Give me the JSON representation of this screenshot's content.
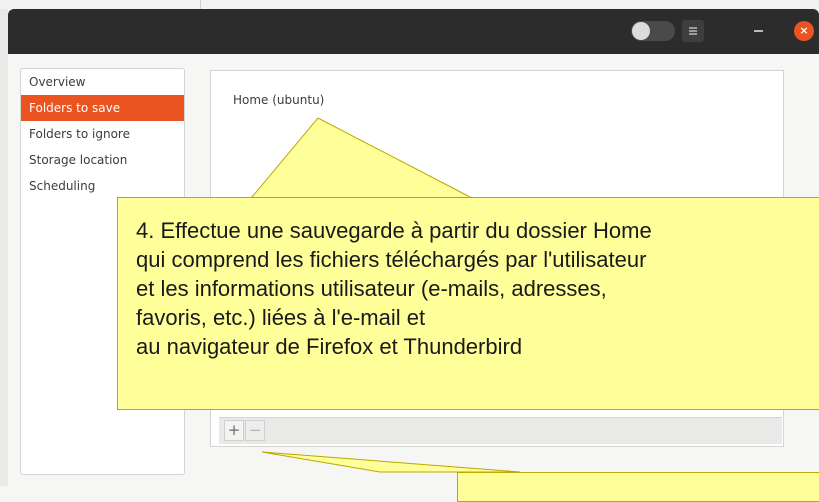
{
  "window": {
    "controls": {
      "toggle_icon": "toggle-switch-icon",
      "menu_icon": "hamburger-menu-icon",
      "minimize_icon": "minimize-icon",
      "close_icon": "close-icon",
      "close_glyph": "×"
    },
    "accent_color": "#e95420"
  },
  "sidebar": {
    "items": [
      {
        "label": "Overview"
      },
      {
        "label": "Folders to save"
      },
      {
        "label": "Folders to ignore"
      },
      {
        "label": "Storage location"
      },
      {
        "label": "Scheduling"
      }
    ],
    "active_index": 1
  },
  "main": {
    "folders": [
      "Home (ubuntu)"
    ],
    "toolbar": {
      "add_label": "+",
      "remove_label": "−"
    }
  },
  "annotation": {
    "text": "4. Effectue une sauvegarde à partir du dossier Home\nqui comprend les fichiers téléchargés par l'utilisateur\net les informations utilisateur (e-mails, adresses,\nfavoris, etc.) liées à l'e-mail et\nau navigateur de Firefox et Thunderbird",
    "background": "#ffff99"
  }
}
